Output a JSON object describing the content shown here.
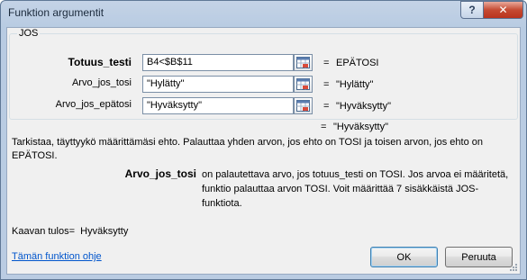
{
  "window": {
    "title": "Funktion argumentit",
    "help_glyph": "?",
    "close_glyph": "✕"
  },
  "function_group": {
    "name": "JOS",
    "arguments": [
      {
        "label": "Totuus_testi",
        "value": "B4<$B$11",
        "result": "EPÄTOSI"
      },
      {
        "label": "Arvo_jos_tosi",
        "value": "\"Hylätty\"",
        "result": "\"Hylätty\""
      },
      {
        "label": "Arvo_jos_epätosi",
        "value": "\"Hyväksytty\"",
        "result": "\"Hyväksytty\""
      }
    ],
    "equals": "="
  },
  "function_result": {
    "value": "\"Hyväksytty\""
  },
  "description": "Tarkistaa, täyttyykö määrittämäsi ehto. Palauttaa yhden arvon, jos ehto on TOSI ja toisen arvon, jos ehto on EPÄTOSI.",
  "argument_help": {
    "label": "Arvo_jos_tosi",
    "text": "on palautettava arvo, jos totuus_testi on TOSI. Jos arvoa ei määritetä, funktio palauttaa arvon TOSI. Voit määrittää 7 sisäkkäistä JOS-funktiota."
  },
  "formula_result": {
    "label": "Kaavan tulos=",
    "value": "Hyväksytty"
  },
  "help_link": "Tämän funktion ohje",
  "buttons": {
    "ok": "OK",
    "cancel": "Peruuta"
  },
  "icons": {
    "ref": "range-picker-icon",
    "grip": "resize-grip-icon"
  }
}
